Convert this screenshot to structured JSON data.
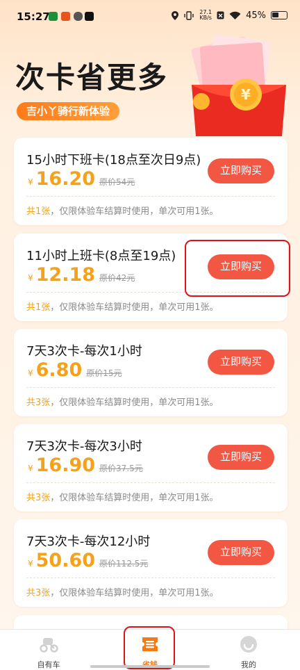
{
  "status_bar": {
    "time": "15:27",
    "net_speed_value": "27.1",
    "net_speed_unit": "KB/s",
    "battery": "45%"
  },
  "header": {
    "title": "次卡省更多",
    "subtitle": "吉小丫骑行新体验"
  },
  "cards": [
    {
      "title": "15小时下班卡(18点至次日9点)",
      "currency": "¥",
      "price": "16.20",
      "original_price": "原价54元",
      "buy_label": "立即购买",
      "note_count": "共1张",
      "note_text": "，仅限体验车结算时使用，单次可用1张。"
    },
    {
      "title": "11小时上班卡(8点至19点)",
      "currency": "¥",
      "price": "12.18",
      "original_price": "原价42元",
      "buy_label": "立即购买",
      "note_count": "共1张",
      "note_text": "，仅限体验车结算时使用，单次可用1张。"
    },
    {
      "title": "7天3次卡-每次1小时",
      "currency": "¥",
      "price": "6.80",
      "original_price": "原价15元",
      "buy_label": "立即购买",
      "note_count": "共3张",
      "note_text": "，仅限体验车结算时使用，单次可用1张。"
    },
    {
      "title": "7天3次卡-每次3小时",
      "currency": "¥",
      "price": "16.90",
      "original_price": "原价37.5元",
      "buy_label": "立即购买",
      "note_count": "共3张",
      "note_text": "，仅限体验车结算时使用，单次可用1张。"
    },
    {
      "title": "7天3次卡-每次12小时",
      "currency": "¥",
      "price": "50.60",
      "original_price": "原价112.5元",
      "buy_label": "立即购买",
      "note_count": "共3张",
      "note_text": "，仅限体验车结算时使用，单次可用1张。"
    }
  ],
  "bottom_nav": {
    "items": [
      {
        "label": "自有车",
        "icon": "scooter-icon",
        "active": false
      },
      {
        "label": "省钱",
        "icon": "ticket-icon",
        "active": true
      },
      {
        "label": "我的",
        "icon": "profile-icon",
        "active": false
      }
    ]
  },
  "colors": {
    "accent": "#f25744",
    "price": "#f4a11b",
    "nav_active": "#f57a14",
    "highlight": "#d9141c"
  }
}
